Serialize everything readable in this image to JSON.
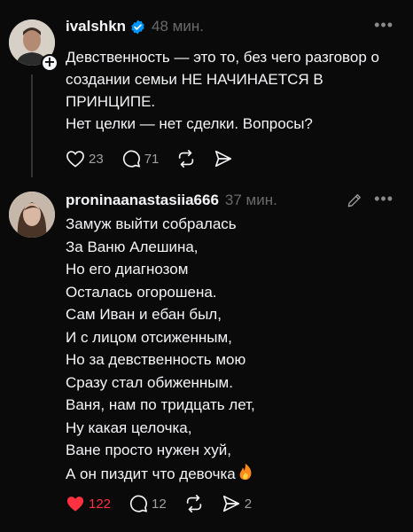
{
  "posts": [
    {
      "username": "ivalshkn",
      "verified": true,
      "time": "48 мин.",
      "lines": [
        "Девственность — это то, без чего разговор о создании семьи НЕ НАЧИНАЕТСЯ В ПРИНЦИПЕ.",
        "Нет целки — нет сделки. Вопросы?"
      ],
      "likes": "23",
      "comments": "71",
      "shares": ""
    },
    {
      "username": "proninaanastasiia666",
      "verified": false,
      "time": "37 мин.",
      "lines": [
        "Замуж выйти собралась",
        "За Ваню Алешина,",
        "Но его диагнозом",
        "Осталась огорошена.",
        "Сам Иван и ебан был,",
        "И с лицом отсиженным,",
        "Но за девственность мою",
        "Сразу стал обиженным.",
        "Ваня, нам по тридцать лет,",
        "Ну какая целочка,",
        "Ване просто нужен хуй,",
        "А он пиздит что девочка"
      ],
      "emoji": "fire-emoji",
      "likes": "122",
      "liked": true,
      "comments": "12",
      "shares": "2"
    }
  ],
  "colors": {
    "background": "#0a0a0a",
    "text": "#f3f5f7",
    "muted": "#6a6a6a",
    "like_active": "#ff3040",
    "verified": "#0095f6"
  }
}
